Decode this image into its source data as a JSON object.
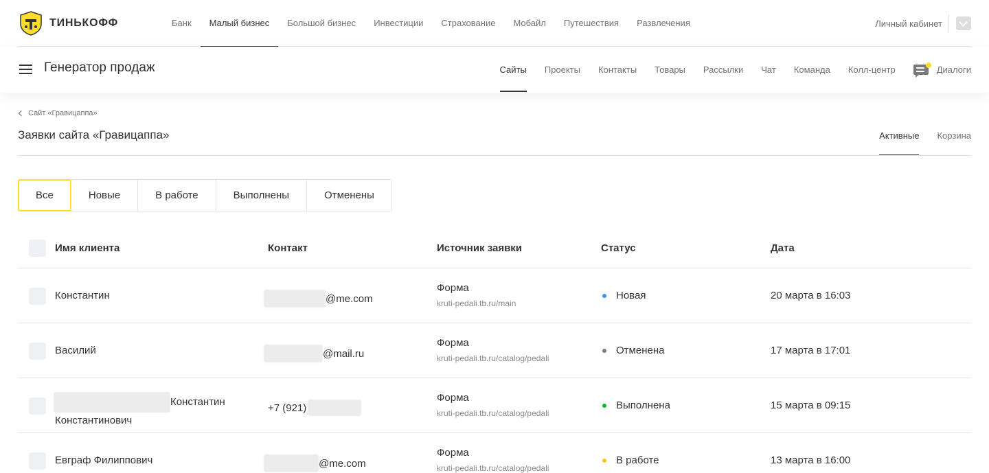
{
  "brand": {
    "name": "ТИНЬКОФФ"
  },
  "top_nav": [
    {
      "label": "Банк",
      "active": false
    },
    {
      "label": "Малый бизнес",
      "active": true
    },
    {
      "label": "Большой бизнес",
      "active": false
    },
    {
      "label": "Инвестиции",
      "active": false
    },
    {
      "label": "Страхование",
      "active": false
    },
    {
      "label": "Мобайл",
      "active": false
    },
    {
      "label": "Путешествия",
      "active": false
    },
    {
      "label": "Развлечения",
      "active": false
    }
  ],
  "cabinet": {
    "label": "Личный кабинет",
    "icon": "chevron-down-icon"
  },
  "product": {
    "title": "Генератор продаж",
    "nav": [
      {
        "label": "Сайты",
        "active": true
      },
      {
        "label": "Проекты",
        "active": false
      },
      {
        "label": "Контакты",
        "active": false
      },
      {
        "label": "Товары",
        "active": false
      },
      {
        "label": "Рассылки",
        "active": false
      },
      {
        "label": "Чат",
        "active": false
      },
      {
        "label": "Команда",
        "active": false
      },
      {
        "label": "Колл-центр",
        "active": false
      }
    ],
    "dialogs": {
      "label": "Диалоги",
      "icon": "chat-bubble-icon"
    }
  },
  "page": {
    "back_label": "Сайт «Гравицаппа»",
    "title": "Заявки сайта «Гравицаппа»",
    "tabs": [
      {
        "label": "Активные",
        "active": true
      },
      {
        "label": "Корзина",
        "active": false
      }
    ]
  },
  "filters": [
    {
      "label": "Все",
      "active": true
    },
    {
      "label": "Новые",
      "active": false
    },
    {
      "label": "В работе",
      "active": false
    },
    {
      "label": "Выполнены",
      "active": false
    },
    {
      "label": "Отменены",
      "active": false
    }
  ],
  "table": {
    "columns": [
      "Имя клиента",
      "Контакт",
      "Источник заявки",
      "Статус",
      "Дата"
    ],
    "rows": [
      {
        "name": "Константин",
        "name_line2": "",
        "contact": "@me.com",
        "source_type": "Форма",
        "source_url": "kruti-pedali.tb.ru/main",
        "status": "Новая",
        "status_color": "#428bf9",
        "date": "20 марта в 16:03"
      },
      {
        "name": "Василий",
        "name_line2": "",
        "contact": "@mail.ru",
        "source_type": "Форма",
        "source_url": "kruti-pedali.tb.ru/catalog/pedali",
        "status": "Отменена",
        "status_color": "#7a7a7a",
        "date": "17 марта в 17:01"
      },
      {
        "name": "Константин",
        "name_line2": "Константинович",
        "contact": "+7 (921)",
        "source_type": "Форма",
        "source_url": "kruti-pedali.tb.ru/catalog/pedali",
        "status": "Выполнена",
        "status_color": "#00b92d",
        "date": "15 марта в 09:15"
      },
      {
        "name": "Евграф Филиппович",
        "name_line2": "",
        "contact": "@me.com",
        "source_type": "Форма",
        "source_url": "kruti-pedali.tb.ru/catalog/pedali",
        "status": "В работе",
        "status_color": "#ffc710",
        "date": "13 марта в 16:00"
      }
    ]
  }
}
